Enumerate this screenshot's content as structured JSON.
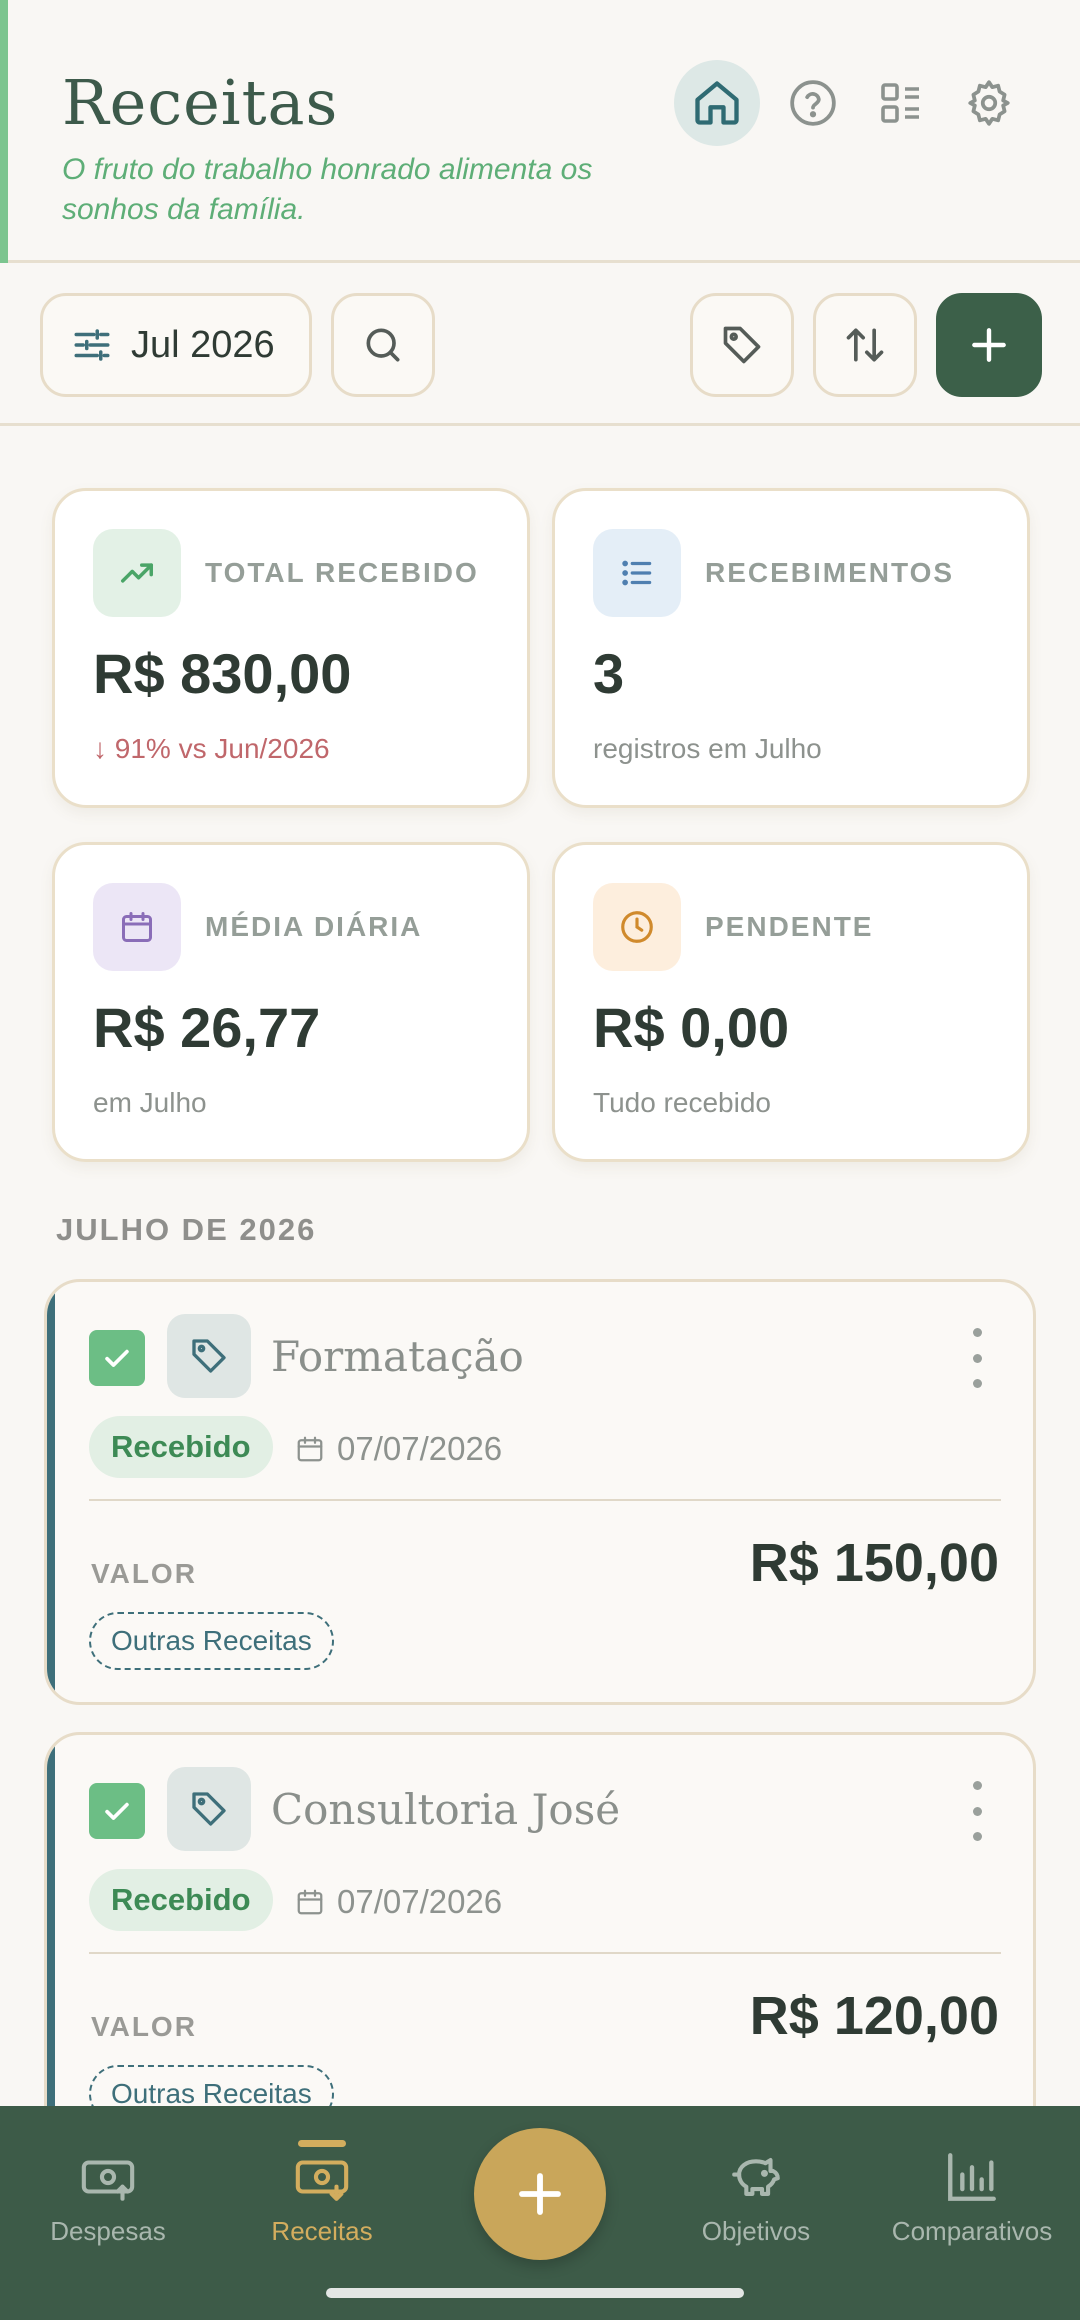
{
  "header": {
    "title": "Receitas",
    "subtitle": "O fruto do trabalho honrado alimenta os sonhos da família."
  },
  "toolbar": {
    "period": "Jul 2026"
  },
  "cards": [
    {
      "label": "TOTAL RECEBIDO",
      "value": "R$ 830,00",
      "note": "↓ 91% vs Jun/2026",
      "icon": "trending-up-icon"
    },
    {
      "label": "RECEBIMENTOS",
      "value": "3",
      "note": "registros em Julho",
      "icon": "list-icon"
    },
    {
      "label": "MÉDIA DIÁRIA",
      "value": "R$ 26,77",
      "note": "em Julho",
      "icon": "calendar-icon"
    },
    {
      "label": "PENDENTE",
      "value": "R$ 0,00",
      "note": "Tudo recebido",
      "icon": "clock-icon"
    }
  ],
  "section": {
    "title": "JULHO DE 2026"
  },
  "entries": [
    {
      "name": "Formatação",
      "status": "Recebido",
      "date": "07/07/2026",
      "value_label": "VALOR",
      "amount": "R$ 150,00",
      "category": "Outras Receitas"
    },
    {
      "name": "Consultoria José",
      "status": "Recebido",
      "date": "07/07/2026",
      "value_label": "VALOR",
      "amount": "R$ 120,00",
      "category": "Outras Receitas"
    }
  ],
  "nav": {
    "items": [
      {
        "label": "Despesas",
        "icon": "money-out-icon"
      },
      {
        "label": "Receitas",
        "icon": "money-in-icon"
      },
      {
        "label": "Objetivos",
        "icon": "piggy-bank-icon"
      },
      {
        "label": "Comparativos",
        "icon": "bar-chart-icon"
      }
    ]
  },
  "colors": {
    "accent_green": "#3c6049",
    "gold": "#c9a65a",
    "received_green": "#3d8a55",
    "negative": "#c0676b"
  }
}
